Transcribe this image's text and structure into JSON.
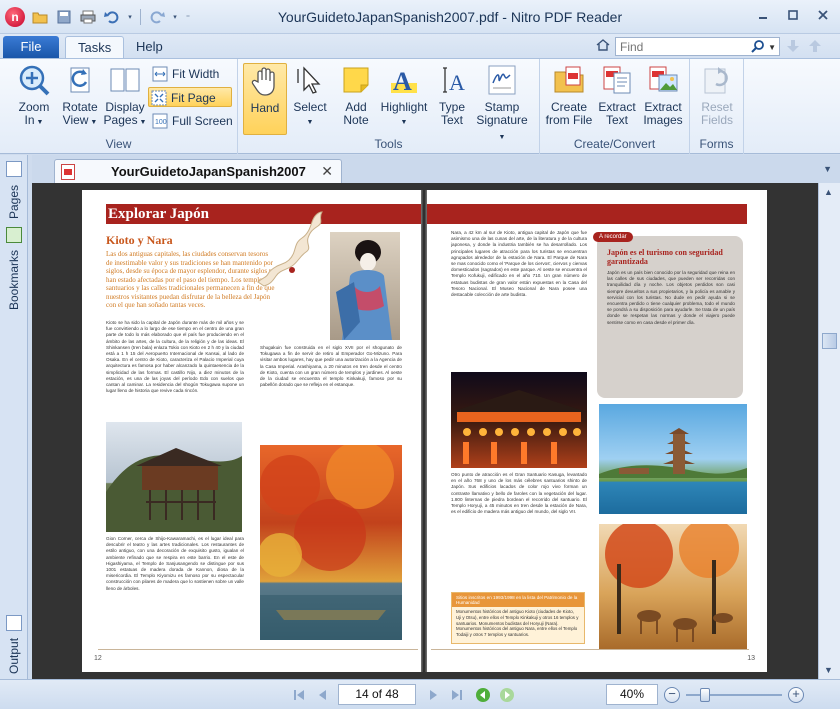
{
  "window": {
    "title": "YourGuidetoJapanSpanish2007.pdf - Nitro PDF Reader",
    "logo": "nitro-logo"
  },
  "menu": {
    "file_label": "File",
    "tabs": [
      {
        "label": "Tasks",
        "active": true
      },
      {
        "label": "Help",
        "active": false
      }
    ],
    "find_placeholder": "Find"
  },
  "ribbon": {
    "view_group": {
      "label": "View",
      "zoom_in": "Zoom\nIn",
      "rotate_view": "Rotate\nView",
      "display_pages": "Display\nPages",
      "fit_width": "Fit Width",
      "fit_page": "Fit Page",
      "full_screen": "Full Screen"
    },
    "tools_group": {
      "label": "Tools",
      "hand": "Hand",
      "select": "Select",
      "add_note": "Add\nNote",
      "highlight": "Highlight",
      "type_text": "Type\nText",
      "stamp_signature": "Stamp\nSignature"
    },
    "create_group": {
      "label": "Create/Convert",
      "create_from_file": "Create\nfrom File",
      "extract_text": "Extract\nText",
      "extract_images": "Extract\nImages"
    },
    "forms_group": {
      "label": "Forms",
      "reset_fields": "Reset\nFields"
    }
  },
  "side_panels": {
    "pages": "Pages",
    "bookmarks": "Bookmarks",
    "output": "Output"
  },
  "document": {
    "tab_name": "YourGuidetoJapanSpanish2007",
    "left_page": {
      "header": "Explorar Japón",
      "subheading": "Kioto y Nara",
      "intro": "Las dos antiguas capitales, las ciudades conservan tesoros de inestimable valor y sus tradiciones se han mantenido por siglos, desde su época de mayor esplendor, durante siglos no han estado afectadas por el paso del tiempo. Los templos, santuarios y las calles tradicionales permanecen a fin de que nuestros visitantes puedan disfrutar de la belleza del Japón con el que han soñado tantas veces.",
      "col1_text": "Kioto se ha sido la capital de Japón durante más de mil años y se fue convirtiendo a lo largo de ese tiempo en el centro de una gran parte de todo lo más elaborado que el país fue produciendo en el ámbito de las artes, de la cultura, de la religión y de las ideas. El Shinkansen (tren bala) enlaza Tokio con Kioto en 2 h 40 y la ciudad está a 1 h 15 del Aeropuerto Internacional de Kansai, al lado de Osaka. En el centro de Kioto, caracteriza el Palacio Imperial cuya arquitectura es famosa por haber alcanzado la quintaesencia de la simplicidad de las formas. El castillo Nijo, a diez minutos de la estación, es una de las joyas del período Edo con suelos que cantan al caminar. La residencia del shogún Tokugawa supone un lugar lleno de historia que revive cada rincón.",
      "col2_text": "Shugakuin fue construida en el siglo XVII por el shogunato de Tokugawa a fin de servir de retiro al Emperador Go-Mizuno. Para visitar ambos lugares, hay que pedir una autorización a la Agencia de la Casa Imperial. Arashiyama, a 20 minutos en tren desde el centro de Kioto, cuenta con un gran número de templos y jardines. Al oeste de la ciudad se encuentra el templo Kinkakuji, famoso por su pabellón dorado que se refleja en el estanque.",
      "col1b_text": "Gion Corner, cerca de Shijo-Kawaramachi, es el lugar ideal para descubrir el teatro y las artes tradicionales. Los restaurantes de estilo antiguo, con una decoración de exquisito gusto, igualan el ambiente refinado que se respira en este barrio. En el este de Higashiyama, el Templo de Sanjusangendo se distingue por sus 1001 estatuas de madera dorada de Kannon, diosa de la misericordia. El Templo Kiyomizu es famoso por su espectacular construcción con pilares de madera que lo sostienen sobre un valle lleno de árboles.",
      "page_number": "12"
    },
    "right_page": {
      "col1_text": "Nara, a 42 km al sur de Kioto, antigua capital de Japón que fue asimismo una de las cunas del arte, de la literatura y de la cultura japonesa, y donde la industria también se ha desarrollado. Los principales lugares de atracción para los turistas se encuentran agrupados alrededor de la estación de Nara. El Parque de Nara se mas conocido como el 'Parque de los ciervos', ciervos y ciervas domesticados (sagrados) en este parque. Al oeste se encuentra el Templo Kofukuji, edificado en el año 710. Un gran número de estatuas budistas de gran valor están expuestas en la Casa del Tesoro Nacional. El Museo Nacional de Nara posee una destacable colección de arte budista.",
      "col1b_text": "Otro punto de atracción es el Gran Santuario Kasuga, levantado en el año 768 y uno de los más célebres santuarios shinto de Japón. Sus edificios lacados de color rojo vivo forman un contraste llamativo y bello de faroles con la vegetación del lugar. 1.800 linternas de piedra bordean el recorrido del santuario. El Templo Horyuji, a 45 minutos en tren desde la estación de Nara, es el edificio de madera más antiguo del mundo, del siglo VII.",
      "badge": "A recordar",
      "box_title": "Japón es el turismo con seguridad garantizada",
      "box_text": "Japón es un país bien conocido por la seguridad que reina en las calles de sus ciudades, que pueden ser recorridas con tranquilidad día y noche. Los objetos perdidos son casi siempre devueltos a sus propietarios, y la policía es amable y servicial con los turistas. No dude en pedir ayuda si se encuentra perdido o tiene cualquier problema, todo el mundo se pondrá a su disposición para ayudarle. Se trata de un país donde se respetan las normas y donde el viajero puede sentirse como en casa desde el primer día.",
      "heritage_title": "Sitios inscritos en 1993/1998 en la lista del Patrimonio de la Humanidad",
      "heritage_text": "Monumentos históricos del antiguo Kioto (ciudades de Kioto, Uji y Otsu), entre ellos el Templo Kinkakuji y otros 16 templos y santuarios. Monumentos budistas del Horyuji (Nara). Monumentos históricos del antiguo Nara, entre ellos el Templo Todaiji y otros 7 templos y santuarios.",
      "page_number": "13"
    }
  },
  "status": {
    "page_indicator": "14 of 48",
    "zoom": "40%"
  },
  "colors": {
    "accent_red": "#a8231e",
    "ribbon_blue": "#1a56a9",
    "selected_yellow": "#ffd25a"
  }
}
